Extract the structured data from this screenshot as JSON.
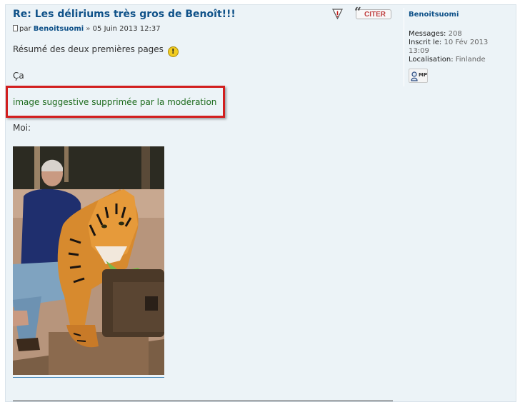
{
  "post": {
    "title": "Re: Les déliriums très gros de Benoît!!!",
    "byline_prefix": "par",
    "author": "Benoitsuomi",
    "separator": "»",
    "date": "05 Juin 2013 12:37",
    "quote_button_label": "CITER",
    "content": {
      "line1": "Résumé des deux premières pages",
      "line2": "Ça",
      "moderation_note": "image suggestive supprimée par la modération",
      "line4": "Moi:"
    },
    "colors": {
      "title": "#105289",
      "moderation_note": "#1e6c1e",
      "highlight_box": "#d21e1e"
    }
  },
  "profile": {
    "username": "Benoitsuomi",
    "messages_label": "Messages:",
    "messages_value": "208",
    "joined_label": "Inscrit le:",
    "joined_value_1": "10 Fév 2013",
    "joined_value_2": "13:09",
    "location_label": "Localisation:",
    "location_value": "Finlande",
    "pm_button_label": "MP"
  },
  "icons": [
    "report-warning-icon",
    "quote-icon",
    "post-icon",
    "exclamation-smiley-icon",
    "user-pm-icon"
  ]
}
